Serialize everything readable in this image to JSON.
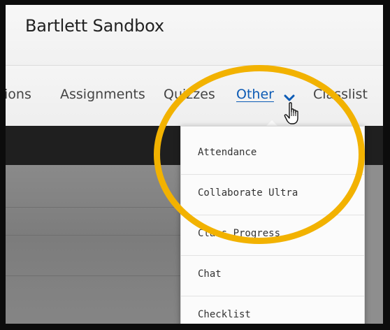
{
  "header": {
    "course_title": "Bartlett Sandbox"
  },
  "navbar": {
    "items": [
      {
        "label": "ions"
      },
      {
        "label": "Assignments"
      },
      {
        "label": "Quizzes"
      },
      {
        "label": "Other"
      },
      {
        "label": "Classlist"
      }
    ],
    "active_item": "Other",
    "active_color": "#0c5bb5"
  },
  "dropdown": {
    "items": [
      {
        "label": "Attendance"
      },
      {
        "label": "Collaborate Ultra"
      },
      {
        "label": "Class Progress"
      },
      {
        "label": "Chat"
      },
      {
        "label": "Checklist"
      }
    ]
  },
  "annotation": {
    "circle_color": "#f2b200"
  },
  "icons": {
    "nav_chevron": "chevron-down-icon",
    "pointer": "hand-pointer-icon"
  }
}
